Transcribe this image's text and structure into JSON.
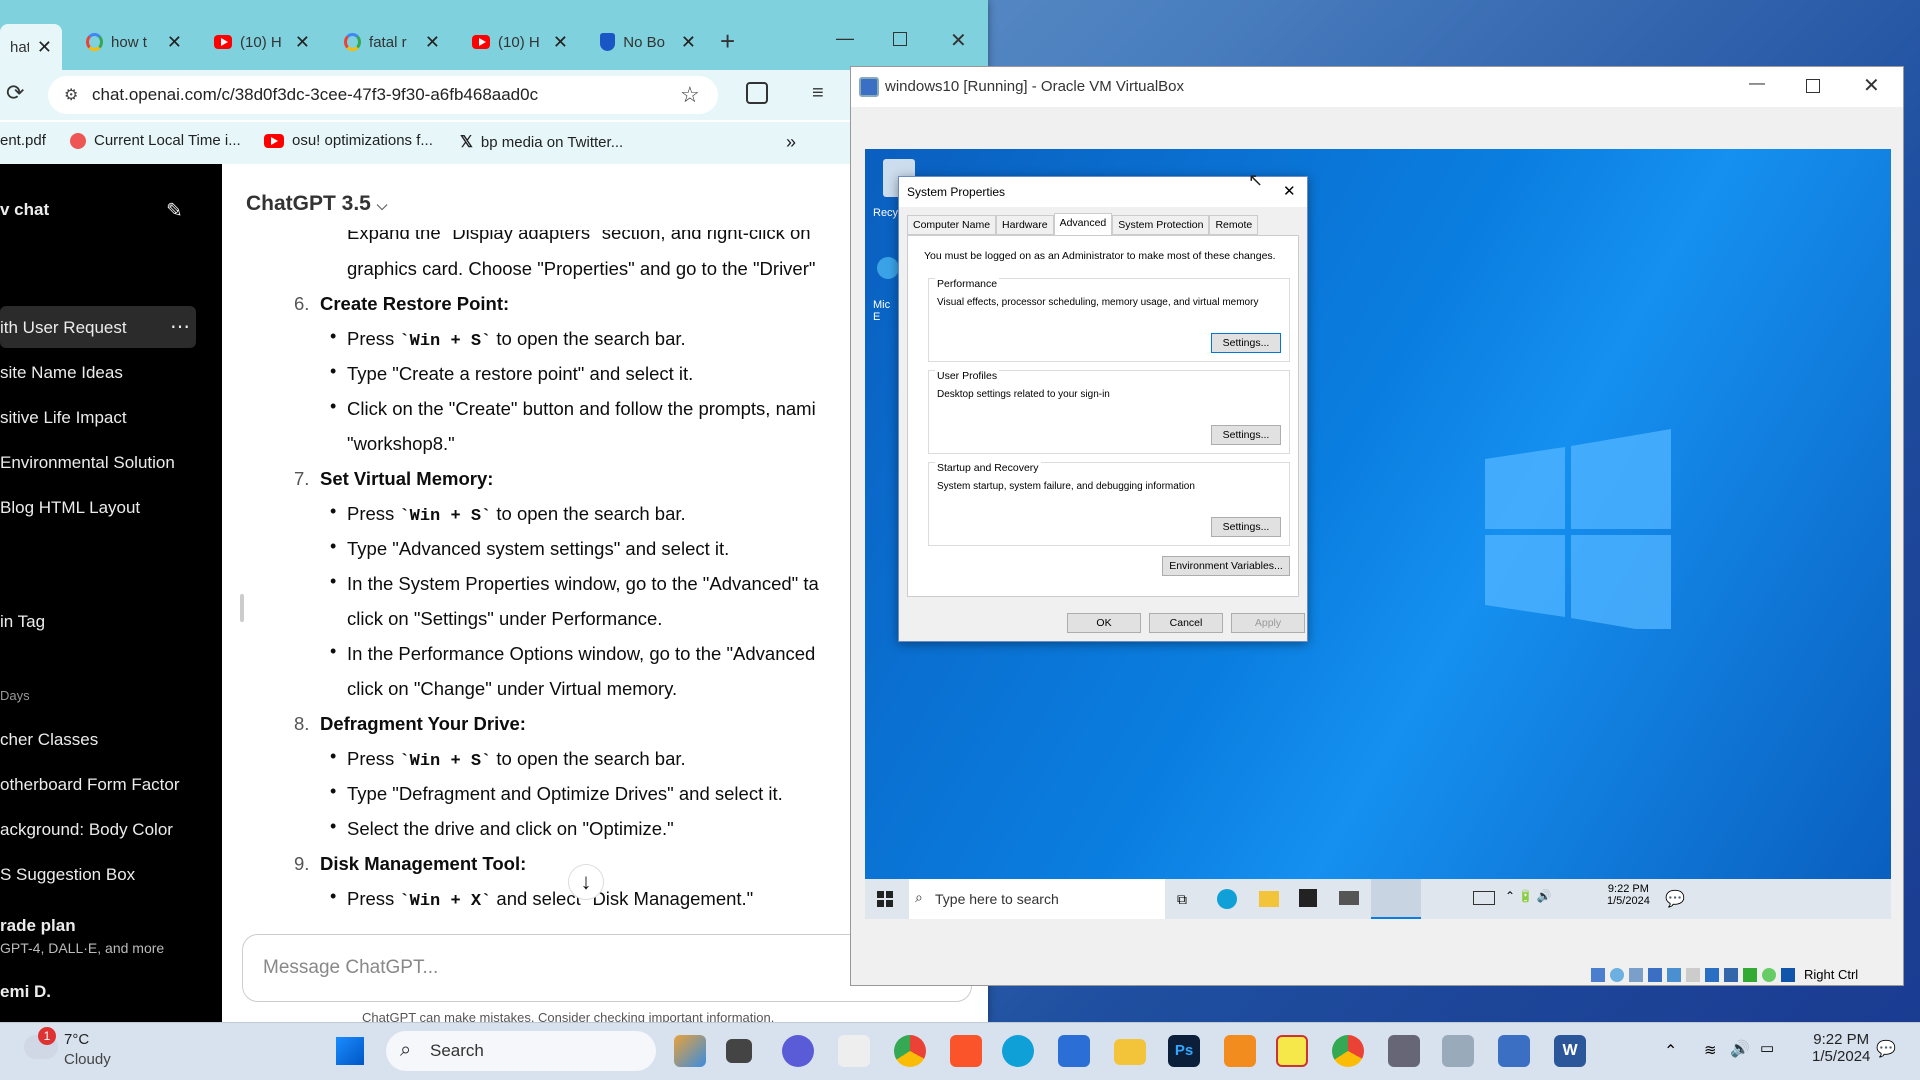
{
  "browser": {
    "tabs": [
      {
        "label": "hatG",
        "icon": "openai"
      },
      {
        "label": "how t",
        "icon": "google"
      },
      {
        "label": "(10) H",
        "icon": "youtube"
      },
      {
        "label": "fatal r",
        "icon": "google"
      },
      {
        "label": "(10) H",
        "icon": "youtube"
      },
      {
        "label": "No Bo",
        "icon": "shield"
      }
    ],
    "url": "chat.openai.com/c/38d0f3dc-3cee-47f3-9f30-a6fb468aad0c",
    "bookmarks": [
      "ent.pdf",
      "Current Local Time i...",
      "osu! optimizations f...",
      "bp media on Twitter..."
    ]
  },
  "sidebar": {
    "new_chat": "v chat",
    "items": [
      "ith User Request",
      "site Name Ideas",
      "sitive Life Impact",
      "Environmental Solution",
      "Blog HTML Layout",
      "in Tag"
    ],
    "section_label": "Days",
    "items2": [
      "cher Classes",
      "otherboard Form Factor",
      "ackground: Body Color",
      "S Suggestion Box"
    ],
    "upgrade_title": "rade plan",
    "upgrade_sub": "GPT-4, DALL·E, and more",
    "user": "emi D."
  },
  "chat": {
    "model": "ChatGPT 3.5",
    "lines": {
      "l0": "Expand the \"Display adapters\" section, and right-click on",
      "l1": "graphics card. Choose \"Properties\" and go to the \"Driver\"",
      "h6": "Create Restore Point:",
      "b6a_pre": "Press ",
      "b6a_code": "`Win + S`",
      "b6a_post": " to open the search bar.",
      "b6b": "Type \"Create a restore point\" and select it.",
      "b6c": "Click on the \"Create\" button and follow the prompts, nami",
      "b6c2": "\"workshop8.\"",
      "h7": "Set Virtual Memory:",
      "b7a_pre": "Press ",
      "b7a_code": "`Win + S`",
      "b7a_post": " to open the search bar.",
      "b7b": "Type \"Advanced system settings\" and select it.",
      "b7c": "In the System Properties window, go to the \"Advanced\" ta",
      "b7c2": "click on \"Settings\" under Performance.",
      "b7d": "In the Performance Options window, go to the \"Advanced",
      "b7d2": "click on \"Change\" under Virtual memory.",
      "h8": "Defragment Your Drive:",
      "b8a_pre": "Press ",
      "b8a_code": "`Win + S`",
      "b8a_post": " to open the search bar.",
      "b8b": "Type \"Defragment and Optimize Drives\" and select it.",
      "b8c": "Select the drive and click on \"Optimize.\"",
      "h9": "Disk Management Tool:",
      "b9a_pre": "Press ",
      "b9a_code": "`Win + X`",
      "b9a_post": " and select \"Disk Management.\""
    },
    "numbers": [
      "6.",
      "7.",
      "8.",
      "9."
    ],
    "input_placeholder": "Message ChatGPT...",
    "disclaimer": "ChatGPT can make mistakes. Consider checking important information."
  },
  "vbox": {
    "title": "windows10 [Running] - Oracle VM VirtualBox",
    "host_key": "Right Ctrl"
  },
  "dialog": {
    "title": "System Properties",
    "tabs": [
      "Computer Name",
      "Hardware",
      "Advanced",
      "System Protection",
      "Remote"
    ],
    "admin_note": "You must be logged on as an Administrator to make most of these changes.",
    "perf_title": "Performance",
    "perf_desc": "Visual effects, processor scheduling, memory usage, and virtual memory",
    "profiles_title": "User Profiles",
    "profiles_desc": "Desktop settings related to your sign-in",
    "startup_title": "Startup and Recovery",
    "startup_desc": "System startup, system failure, and debugging information",
    "settings": "Settings...",
    "env": "Environment Variables...",
    "ok": "OK",
    "cancel": "Cancel",
    "apply": "Apply"
  },
  "vm_taskbar": {
    "search": "Type here to search",
    "time": "9:22 PM",
    "date": "1/5/2024"
  },
  "vm_desktop": {
    "recycle": "Recy",
    "edge_label": "Mic E"
  },
  "taskbar": {
    "temp": "7°C",
    "weather": "Cloudy",
    "weather_badge": "1",
    "search": "Search",
    "time": "9:22 PM",
    "date": "1/5/2024"
  }
}
